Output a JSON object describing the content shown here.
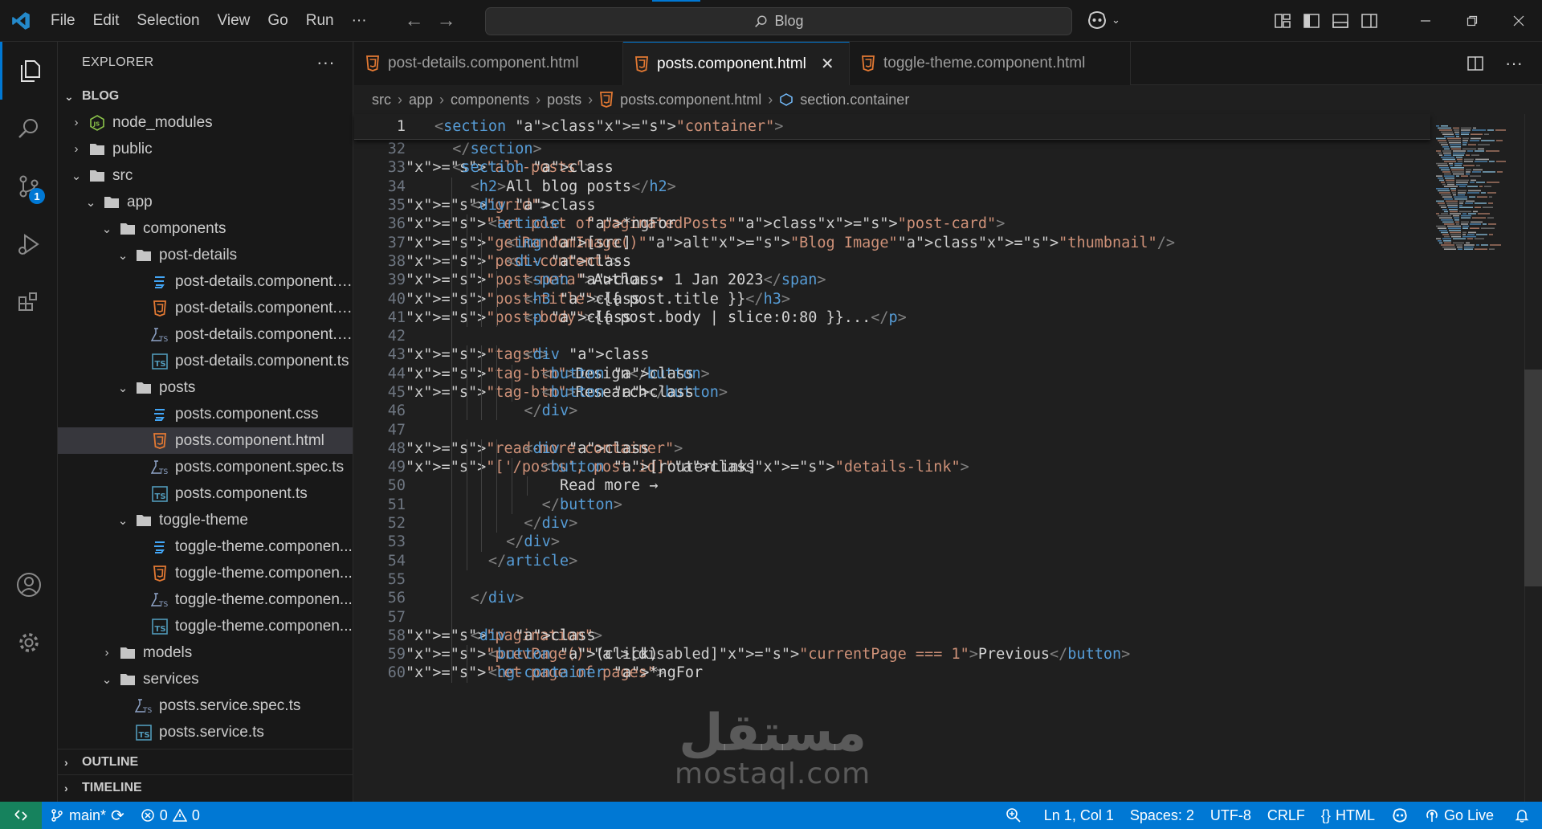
{
  "titlebar": {
    "menu": [
      "File",
      "Edit",
      "Selection",
      "View",
      "Go",
      "Run",
      "···"
    ],
    "search_text": "Blog"
  },
  "activity": {
    "scm_badge": "1"
  },
  "sidebar": {
    "title": "EXPLORER",
    "more": "···",
    "root": "BLOG",
    "tree": [
      {
        "label": "node_modules",
        "depth": 1,
        "type": "folder-node",
        "open": false
      },
      {
        "label": "public",
        "depth": 1,
        "type": "folder",
        "open": false
      },
      {
        "label": "src",
        "depth": 1,
        "type": "folder",
        "open": true
      },
      {
        "label": "app",
        "depth": 2,
        "type": "folder",
        "open": true
      },
      {
        "label": "components",
        "depth": 3,
        "type": "folder",
        "open": true
      },
      {
        "label": "post-details",
        "depth": 4,
        "type": "folder",
        "open": true
      },
      {
        "label": "post-details.component.css",
        "depth": 5,
        "type": "css"
      },
      {
        "label": "post-details.component.h...",
        "depth": 5,
        "type": "html"
      },
      {
        "label": "post-details.component.s...",
        "depth": 5,
        "type": "spec"
      },
      {
        "label": "post-details.component.ts",
        "depth": 5,
        "type": "ts"
      },
      {
        "label": "posts",
        "depth": 4,
        "type": "folder",
        "open": true
      },
      {
        "label": "posts.component.css",
        "depth": 5,
        "type": "css"
      },
      {
        "label": "posts.component.html",
        "depth": 5,
        "type": "html",
        "selected": true
      },
      {
        "label": "posts.component.spec.ts",
        "depth": 5,
        "type": "spec"
      },
      {
        "label": "posts.component.ts",
        "depth": 5,
        "type": "ts"
      },
      {
        "label": "toggle-theme",
        "depth": 4,
        "type": "folder",
        "open": true
      },
      {
        "label": "toggle-theme.componen...",
        "depth": 5,
        "type": "css"
      },
      {
        "label": "toggle-theme.componen...",
        "depth": 5,
        "type": "html"
      },
      {
        "label": "toggle-theme.componen...",
        "depth": 5,
        "type": "spec"
      },
      {
        "label": "toggle-theme.componen...",
        "depth": 5,
        "type": "ts"
      },
      {
        "label": "models",
        "depth": 3,
        "type": "folder",
        "open": false
      },
      {
        "label": "services",
        "depth": 3,
        "type": "folder",
        "open": true
      },
      {
        "label": "posts.service.spec.ts",
        "depth": 4,
        "type": "spec"
      },
      {
        "label": "posts.service.ts",
        "depth": 4,
        "type": "ts"
      }
    ],
    "outline": "OUTLINE",
    "timeline": "TIMELINE"
  },
  "tabs": [
    {
      "label": "post-details.component.html",
      "active": false
    },
    {
      "label": "posts.component.html",
      "active": true
    },
    {
      "label": "toggle-theme.component.html",
      "active": false
    }
  ],
  "breadcrumb": [
    "src",
    "app",
    "components",
    "posts",
    "posts.component.html",
    "section.container"
  ],
  "sticky": {
    "ln": "1",
    "code": "<section class=\"container\">"
  },
  "code_lines": [
    {
      "ln": "32",
      "indent": 1,
      "code": "</section>"
    },
    {
      "ln": "33",
      "indent": 1,
      "code": "<section class=\"all-posts\">"
    },
    {
      "ln": "34",
      "indent": 2,
      "code": "<h2>All blog posts</h2>"
    },
    {
      "ln": "35",
      "indent": 2,
      "code": "<div class=\"grid\">"
    },
    {
      "ln": "36",
      "indent": 3,
      "code": "<article   *ngFor=\"let post of paginatedPosts\" class=\"post-card\">"
    },
    {
      "ln": "37",
      "indent": 4,
      "code": "<img [src]=\"getRandomImage()\" alt=\"Blog Image\" class=\"thumbnail\" />"
    },
    {
      "ln": "38",
      "indent": 4,
      "code": "<div class=\"post-content\">"
    },
    {
      "ln": "39",
      "indent": 5,
      "code": "<span class=\"post-meta\">Author • 1 Jan 2023</span>"
    },
    {
      "ln": "40",
      "indent": 5,
      "code": "<h3 class=\"post-title\">{{ post.title }}</h3>"
    },
    {
      "ln": "41",
      "indent": 5,
      "code": "<p class=\"post-body\">{{ post.body | slice:0:80 }}...</p>"
    },
    {
      "ln": "42",
      "indent": 0,
      "code": ""
    },
    {
      "ln": "43",
      "indent": 5,
      "code": "<div class=\"tags\">"
    },
    {
      "ln": "44",
      "indent": 6,
      "code": "<button class=\"tag-btn\">Design</button>"
    },
    {
      "ln": "45",
      "indent": 6,
      "code": "<button class=\"tag-btn\">Research</button>"
    },
    {
      "ln": "46",
      "indent": 5,
      "code": "</div>"
    },
    {
      "ln": "47",
      "indent": 0,
      "code": ""
    },
    {
      "ln": "48",
      "indent": 5,
      "code": "<div class=\"read-more-container\">"
    },
    {
      "ln": "49",
      "indent": 6,
      "code": "<button [routerLink]=\"['/posts', post.id]\" class=\"details-link\">"
    },
    {
      "ln": "50",
      "indent": 7,
      "code": "Read more →"
    },
    {
      "ln": "51",
      "indent": 6,
      "code": "</button>"
    },
    {
      "ln": "52",
      "indent": 5,
      "code": "</div>"
    },
    {
      "ln": "53",
      "indent": 4,
      "code": "</div>"
    },
    {
      "ln": "54",
      "indent": 3,
      "code": "</article>"
    },
    {
      "ln": "55",
      "indent": 0,
      "code": ""
    },
    {
      "ln": "56",
      "indent": 2,
      "code": "</div>"
    },
    {
      "ln": "57",
      "indent": 0,
      "code": ""
    },
    {
      "ln": "58",
      "indent": 2,
      "code": "<div class=\"pagination\">"
    },
    {
      "ln": "59",
      "indent": 3,
      "code": "<button (click)=\"prevPage()\" [disabled]=\"currentPage === 1\">Previous</button>"
    },
    {
      "ln": "60",
      "indent": 3,
      "code": "<ng-container *ngFor=\"let page of pages\">"
    }
  ],
  "statusbar": {
    "branch": "main*",
    "errors": "0",
    "warnings": "0",
    "position": "Ln 1, Col 1",
    "spaces": "Spaces: 2",
    "encoding": "UTF-8",
    "eol": "CRLF",
    "language": "HTML",
    "golive": "Go Live"
  },
  "watermark": {
    "line1": "مستقل",
    "line2": "mostaql.com"
  },
  "colors": {
    "accent": "#0078d4",
    "status_remote": "#16825d",
    "tag": "#569cd6",
    "attr": "#9cdcfe",
    "string": "#ce9178",
    "html_icon": "#e37933",
    "css_icon": "#42a5f5",
    "ts_icon": "#519aba"
  }
}
